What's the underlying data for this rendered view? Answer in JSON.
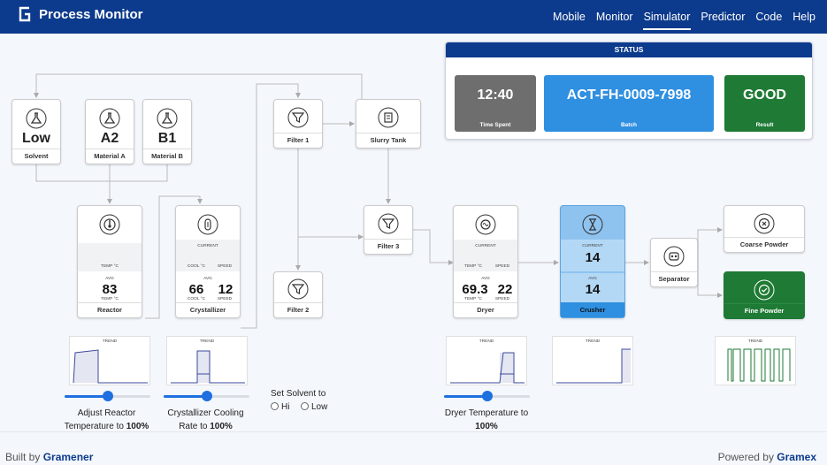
{
  "app": {
    "title": "Process Monitor"
  },
  "nav": {
    "items": [
      "Mobile",
      "Monitor",
      "Simulator",
      "Predictor",
      "Code",
      "Help"
    ],
    "active": "Simulator"
  },
  "status": {
    "title": "STATUS",
    "time_spent": {
      "value": "12:40",
      "label": "Time Spent"
    },
    "batch": {
      "value": "ACT-FH-0009-7998",
      "label": "Batch"
    },
    "result": {
      "value": "GOOD",
      "label": "Result"
    }
  },
  "nodes": {
    "solvent": {
      "value": "Low",
      "label": "Solvent"
    },
    "material_a": {
      "value": "A2",
      "label": "Material A"
    },
    "material_b": {
      "value": "B1",
      "label": "Material B"
    },
    "reactor": {
      "label": "Reactor",
      "temp_label": "TEMP °C",
      "avg_label": "AVG",
      "avg_value": "83",
      "avg_unit": "TEMP °C"
    },
    "crystallizer": {
      "label": "Crystallizer",
      "current_label": "CURRENT",
      "cool_label": "COOL °C",
      "speed_label": "SPEED",
      "avg_label": "AVG",
      "avg_cool": "66",
      "avg_speed": "12"
    },
    "filter1": {
      "label": "Filter 1"
    },
    "filter2": {
      "label": "Filter 2"
    },
    "filter3": {
      "label": "Filter 3"
    },
    "slurry_tank": {
      "label": "Slurry Tank"
    },
    "dryer": {
      "label": "Dryer",
      "current_label": "CURRENT",
      "temp_label": "TEMP °C",
      "speed_label": "SPEED",
      "avg_label": "AVG",
      "avg_temp": "69.3",
      "avg_speed": "22"
    },
    "crusher": {
      "label": "Crusher",
      "current_label": "CURRENT",
      "current_value": "14",
      "avg_label": "AVG",
      "avg_value": "14"
    },
    "separator": {
      "label": "Separator"
    },
    "coarse_powder": {
      "label": "Coarse Powder"
    },
    "fine_powder": {
      "label": "Fine Powder"
    }
  },
  "trend_label": "TREND",
  "controls": {
    "reactor_slider": {
      "value_pct": 50,
      "caption_line1": "Adjust Reactor",
      "caption_line2": "Temperature to",
      "caption_value": "100%"
    },
    "crystallizer_slider": {
      "value_pct": 50,
      "caption_line1": "Crystallizer Cooling",
      "caption_line2": "Rate to",
      "caption_value": "100%"
    },
    "dryer_slider": {
      "value_pct": 50,
      "caption_line1": "Dryer Temperature to",
      "caption_value": "100%"
    },
    "solvent_choice": {
      "label": "Set Solvent to",
      "options": [
        "Hi",
        "Low"
      ]
    }
  },
  "footer": {
    "built_prefix": "Built by",
    "built_brand": "Gramener",
    "powered_prefix": "Powered by",
    "powered_brand": "Gramex"
  },
  "colors": {
    "nav": "#0c3a8c",
    "blue": "#2f8fe0",
    "green": "#1e7a34",
    "gray": "#6e6e6e",
    "crusher": "#8ec3f0",
    "trend_line": "#3b4a9c"
  }
}
